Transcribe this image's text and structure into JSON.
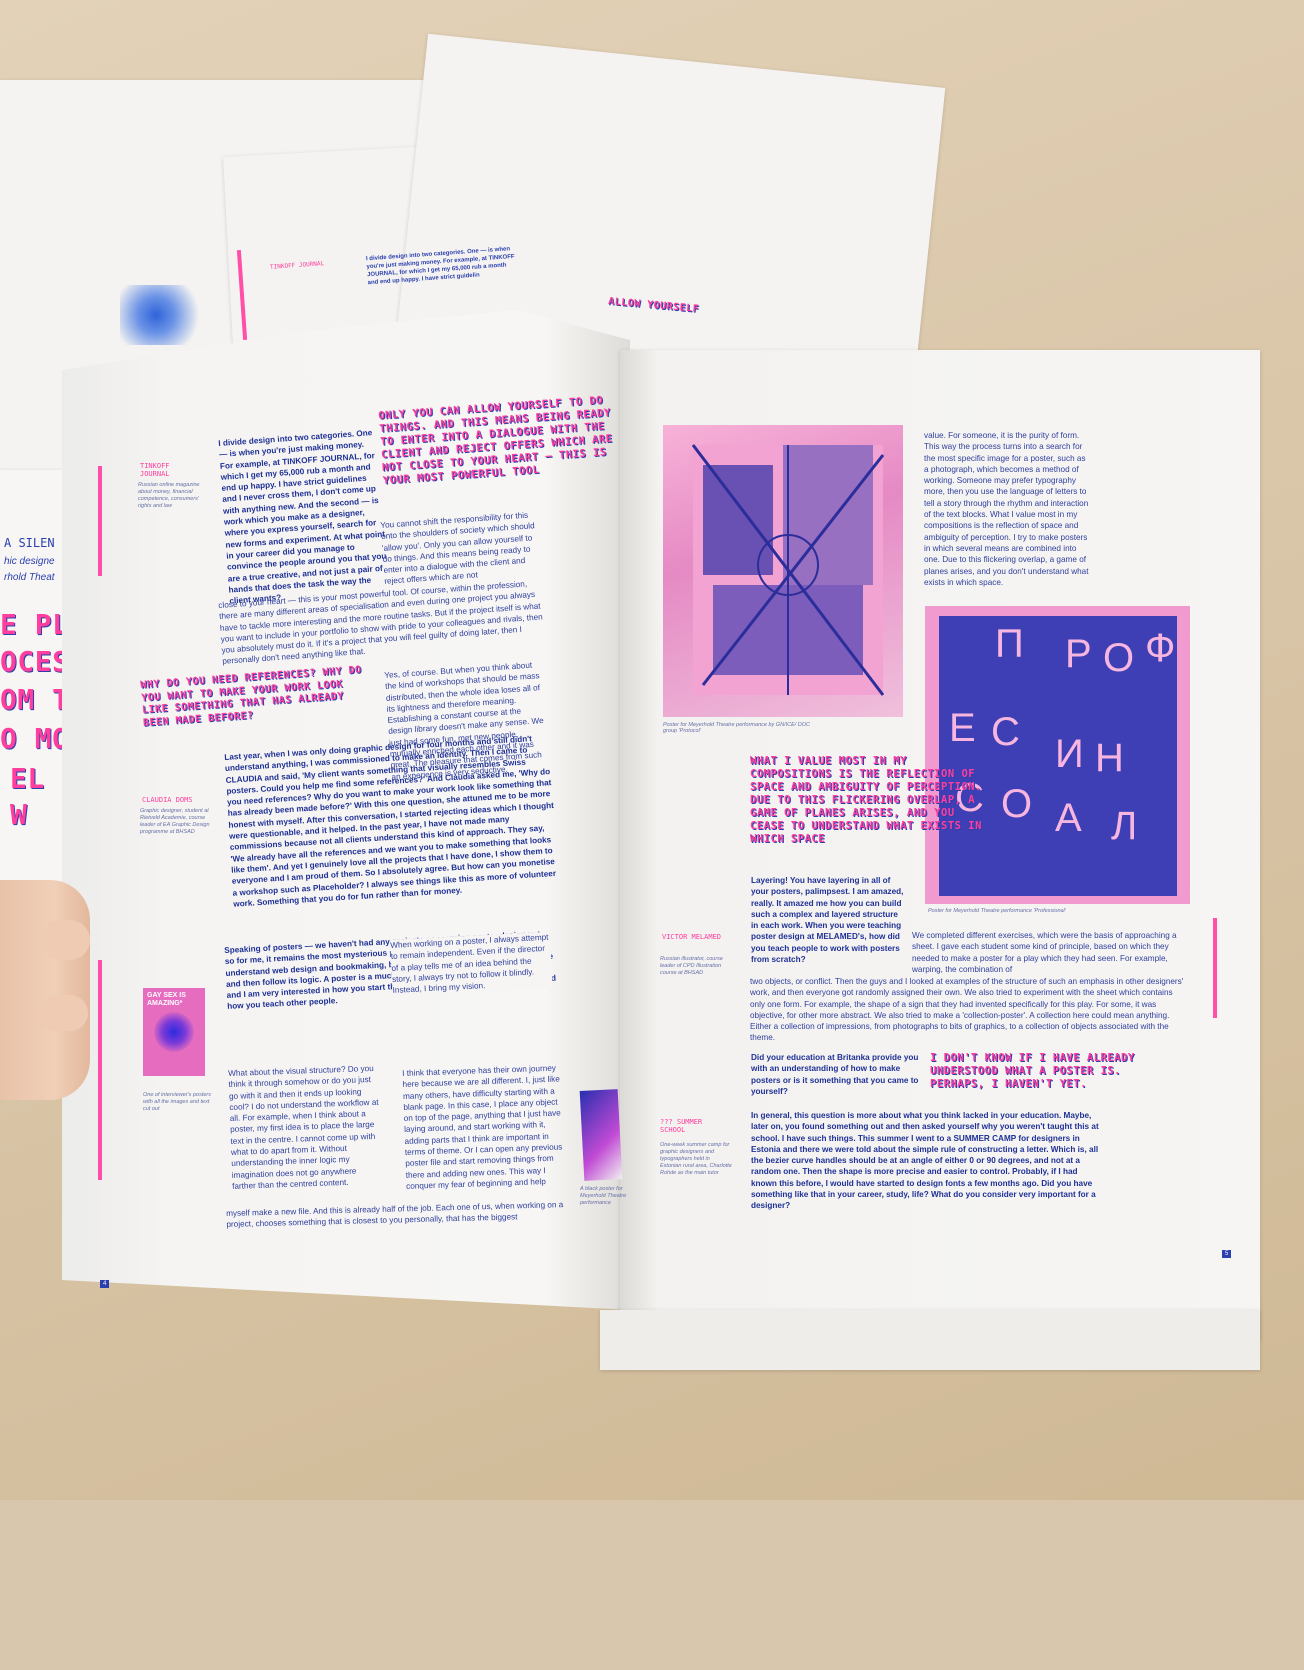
{
  "background_sheets": {
    "left_fragments": [
      "E PL",
      "OCES",
      "OM TI",
      "O MO",
      "EL",
      "W"
    ],
    "left_name": "A SILEN",
    "left_subtitle_1": "hic designe",
    "left_subtitle_2": "rhold Theat",
    "top_label": "TINKOFF JOURNAL",
    "top_quote": "ALLOW YOURSELF",
    "top_text": "I divide design into two categories. One — is when you're just making money. For example, at TINKOFF JOURNAL, for which I get my 65,000 rub a month and end up happy. I have strict guidelin"
  },
  "left_page": {
    "side_label_1": "TINKOFF JOURNAL",
    "side_note_1": "Russian online magazine about money, financial competence, consumers' rights and law",
    "intro_text": "I divide design into two categories. One — is when you're just making money. For example, at TINKOFF JOURNAL, for which I get my 65,000 rub a month and end up happy. I have strict guidelines and I never cross them, I don't come up with anything new. And the second — is work which you make as a designer, where you express yourself, search for new forms and experiment. At what point in your career did you manage to convince the people around you that you are a true creative, and not just a pair of hands that does the task the way the client wants?",
    "quote_1": "Only you can allow yourself to do things. And this means being ready to enter into a dialogue with the client and reject offers which are not close to your heart — this is your most powerful tool",
    "answer_1a": "You cannot shift the responsibility for this onto the shoulders of society which should 'allow you'. Only you can allow yourself to do things. And this means being ready to enter into a dialogue with the client and reject offers which are not",
    "answer_1b": "close to your heart — this is your most powerful tool. Of course, within the profession, there are many different areas of specialisation and even during one project you always have to tackle more interesting and the more routine tasks. But if the project itself is what you want to include in your portfolio to show with pride to your colleagues and rivals, then you absolutely must do it. If it's a project that you will feel guilty of doing later, then I personally don't need anything like that.",
    "question_heading": "Why do you need references? Why do you want to make your work look like something that has already been made before?",
    "answer_2": "Yes, of course. But when you think about the kind of workshops that should be mass distributed, then the whole idea loses all of its lightness and therefore meaning. Establishing a constant course at the design library doesn't make any sense. We just had some fun, met new people, mutually enriched each other and it was great. The pleasure that comes from such an experience is very seductive.",
    "side_label_2": "CLAUDIA DOMS",
    "side_note_2": "Graphic designer, student at Rietveld Academie, course leader of EA Graphic Design programme at BHSAD",
    "claudia_text": "Last year, when I was only doing graphic design for four months and still didn't understand anything, I was commissioned to make an identity. Then I came to CLAUDIA and said, 'My client wants something that visually resembles Swiss posters. Could you help me find some references?' And Claudia asked me, 'Why do you need references? Why do you want to make your work look like something that has already been made before?' With this one question, she attuned me to be more honest with myself. After this conversation, I started rejecting ideas which I thought were questionable, and it helped. In the past year, I have not made many commissions because not all clients understand this kind of approach. They say, 'We already have all the references and we want you to make something that looks like them'. And yet I genuinely love all the projects that I have done, I show them to everyone and I am proud of them. So I absolutely agree. But how can you monetise a workshop such as Placeholder? I always see things like this as more of volunteer work. Something that you do for fun rather than for money.",
    "posters_text": "Speaking of posters — we haven't had any projects concerning poster design yet, so for me, it remains the most mysterious part of the graphic design practice. I understand web design and bookmaking, because you essentially create a structure and then follow its logic. A poster is a much more chaotic genre. I love your posters and I am very interested in how you start them, what kind of decisions you make and how you teach other people.",
    "director_text": "When working on a poster, I always attempt to remain independent. Even if the director of a play tells me of an idea behind the story, I always try not to follow it blindly. Instead, I bring my vision.",
    "poster_title": "GAY SEX IS AMAZING*",
    "poster_caption": "One of interviewer's posters with all the images and text cut out",
    "visual_text": "What about the visual structure? Do you think it through somehow or do you just go with it and then it ends up looking cool? I do not understand the workflow at all. For example, when I think about a poster, my first idea is to place the large text in the centre. I cannot come up with what to do apart from it. Without understanding the inner logic my imagination does not go anywhere farther than the centred content.",
    "journey_text": "I think that everyone has their own journey here because we are all different. I, just like many others, have difficulty starting with a blank page. In this case, I place any object on top of the page, anything that I just have laying around, and start working with it, adding parts that I think are important in terms of theme. Or I can open any previous poster file and start removing things from there and adding new ones. This way I conquer my fear of beginning and help",
    "bottom_text": "myself make a new file. And this is already half of the job. Each one of us, when working on a project, chooses something that is closest to you personally, that has the biggest",
    "small_caption": "A black poster for Meyerhold Theatre performance",
    "page_number": "4"
  },
  "right_page": {
    "purity_text": "value. For someone, it is the purity of form. This way the process turns into a search for the most specific image for a poster, such as a photograph, which becomes a method of working. Someone may prefer typography more, then you use the language of letters to tell a story through the rhythm and interaction of the text blocks. What I value most in my compositions is the reflection of space and ambiguity of perception. I try to make posters in which several means are combined into one. Due to this flickering overlap, a game of planes arises, and you don't understand what exists in which space.",
    "poster1_caption": "Poster for Meyerhold Theatre performance by GN/ICE/ DOC group 'Protocol'",
    "poster2_caption": "Poster for Meyerhold Theatre performance 'Professional'",
    "poster2_letters": [
      "П",
      "Р",
      "О",
      "Ф",
      "Е",
      "С",
      "И",
      "Н",
      "А",
      "Л",
      "С",
      "О"
    ],
    "quote_2": "What I value most in my compositions is the reflection of space and ambiguity of perception. Due to this flickering overlap, a game of planes arises, and you cease to understand what exists in which space",
    "layering_text": "Layering! You have layering in all of your posters, palimpsest. I am amazed, really. It amazed me how you can build such a complex and layered structure in each work. When you were teaching poster design at MELAMED's, how did you teach people to work with posters from scratch?",
    "side_label_3": "VICTOR MELAMED",
    "side_note_3": "Russian illustrator, course leader of CPD Illustration course at BHSAD",
    "exercises_text": "We completed different exercises, which were the basis of approaching a sheet. I gave each student some kind of principle, based on which they needed to make a poster for a play which they had seen. For example, warping, the combination of",
    "objects_text": "two objects, or conflict. Then the guys and I looked at examples of the structure of such an emphasis in other designers' work, and then everyone got randomly assigned their own. We also tried to experiment with the sheet which contains only one form. For example, the shape of a sign that they had invented specifically for this play. For some, it was objective, for other more abstract. We also tried to make a 'collection-poster'. A collection here could mean anything. Either a collection of impressions, from photographs to bits of graphics, to a collection of objects associated with the theme.",
    "britanka_question": "Did your education at Britanka provide you with an understanding of how to make posters or is it something that you came to yourself?",
    "quote_3": "I don't know if I have already understood what a poster is. Perhaps, I haven't yet.",
    "side_label_4": "??? SUMMER SCHOOL",
    "side_note_4": "One-week summer camp for graphic designers and typographers held in Estonian rural area, Charlotte Rohde as the main tutor",
    "summer_text": "In general, this question is more about what you think lacked in your education. Maybe, later on, you found something out and then asked yourself why you weren't taught this at school. I have such things. This summer I went to a SUMMER CAMP for designers in Estonia and there we were told about the simple rule of constructing a letter. Which is, all the bezier curve handles should be at an angle of either 0 or 90 degrees, and not at a random one. Then the shape is more precise and easier to control. Probably, if I had known this before, I would have started to design fonts a few months ago. Did you have something like that in your career, study, life? What do you consider very important for a designer?",
    "page_number": "5"
  },
  "colors": {
    "pink": "#ff3e9d",
    "blue": "#2b3fae",
    "paper": "#f4f3f1",
    "table": "#d9c7ad"
  }
}
